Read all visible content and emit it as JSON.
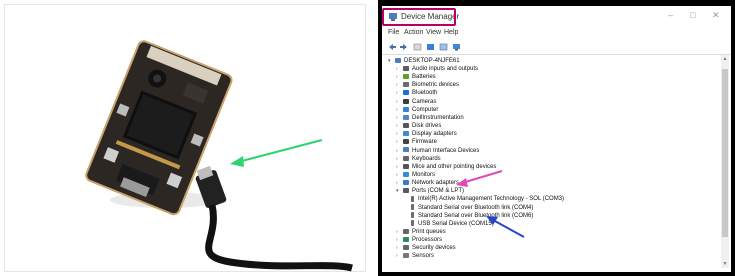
{
  "colors": {
    "highlight_box": "#b5006c",
    "green_arrow": "#2dd36f",
    "pink_arrow": "#e04ab7",
    "blue_arrow": "#2546c9"
  },
  "window": {
    "title": "Device Manager",
    "menu": [
      "File",
      "Action",
      "View",
      "Help"
    ],
    "controls": [
      "–",
      "□",
      "✕"
    ]
  },
  "tree": {
    "root": "DESKTOP-4NJFE61",
    "items": [
      {
        "label": "Audio inputs and outputs",
        "icon": "speaker-icon",
        "color": "#5b5b5b"
      },
      {
        "label": "Batteries",
        "icon": "battery-icon",
        "color": "#5fa02c"
      },
      {
        "label": "Biometric devices",
        "icon": "fingerprint-icon",
        "color": "#6c6c6c"
      },
      {
        "label": "Bluetooth",
        "icon": "bluetooth-icon",
        "color": "#1a6ed8"
      },
      {
        "label": "Cameras",
        "icon": "camera-icon",
        "color": "#3c3c3c"
      },
      {
        "label": "Computer",
        "icon": "computer-icon",
        "color": "#3a7fd5"
      },
      {
        "label": "DellInstrumentation",
        "icon": "gear-icon",
        "color": "#4f87c8"
      },
      {
        "label": "Disk drives",
        "icon": "disk-icon",
        "color": "#555"
      },
      {
        "label": "Display adapters",
        "icon": "monitor-icon",
        "color": "#3a8ad8"
      },
      {
        "label": "Firmware",
        "icon": "chip-icon",
        "color": "#444"
      },
      {
        "label": "Human Interface Devices",
        "icon": "hid-icon",
        "color": "#4a7fbf"
      },
      {
        "label": "Keyboards",
        "icon": "keyboard-icon",
        "color": "#666"
      },
      {
        "label": "Mice and other pointing devices",
        "icon": "mouse-icon",
        "color": "#555"
      },
      {
        "label": "Monitors",
        "icon": "monitor-icon",
        "color": "#3a8ad8"
      },
      {
        "label": "Network adapters",
        "icon": "network-icon",
        "color": "#3a7ac8"
      },
      {
        "label": "Ports (COM & LPT)",
        "icon": "port-icon",
        "color": "#5a5a5a",
        "expanded": true
      },
      {
        "label": "Intel(R) Active Management Technology - SOL (COM3)",
        "icon": "device-icon",
        "child": true
      },
      {
        "label": "Standard Serial over Bluetooth link (COM4)",
        "icon": "device-icon",
        "child": true
      },
      {
        "label": "Standard Serial over Bluetooth link (COM6)",
        "icon": "device-icon",
        "child": true
      },
      {
        "label": "USB Serial Device (COM15)",
        "icon": "device-icon",
        "child": true
      },
      {
        "label": "Print queues",
        "icon": "printer-icon",
        "color": "#666"
      },
      {
        "label": "Processors",
        "icon": "cpu-icon",
        "color": "#2e8b57"
      },
      {
        "label": "Security devices",
        "icon": "security-icon",
        "color": "#666"
      },
      {
        "label": "Sensors",
        "icon": "sensor-icon",
        "color": "#777"
      }
    ]
  }
}
